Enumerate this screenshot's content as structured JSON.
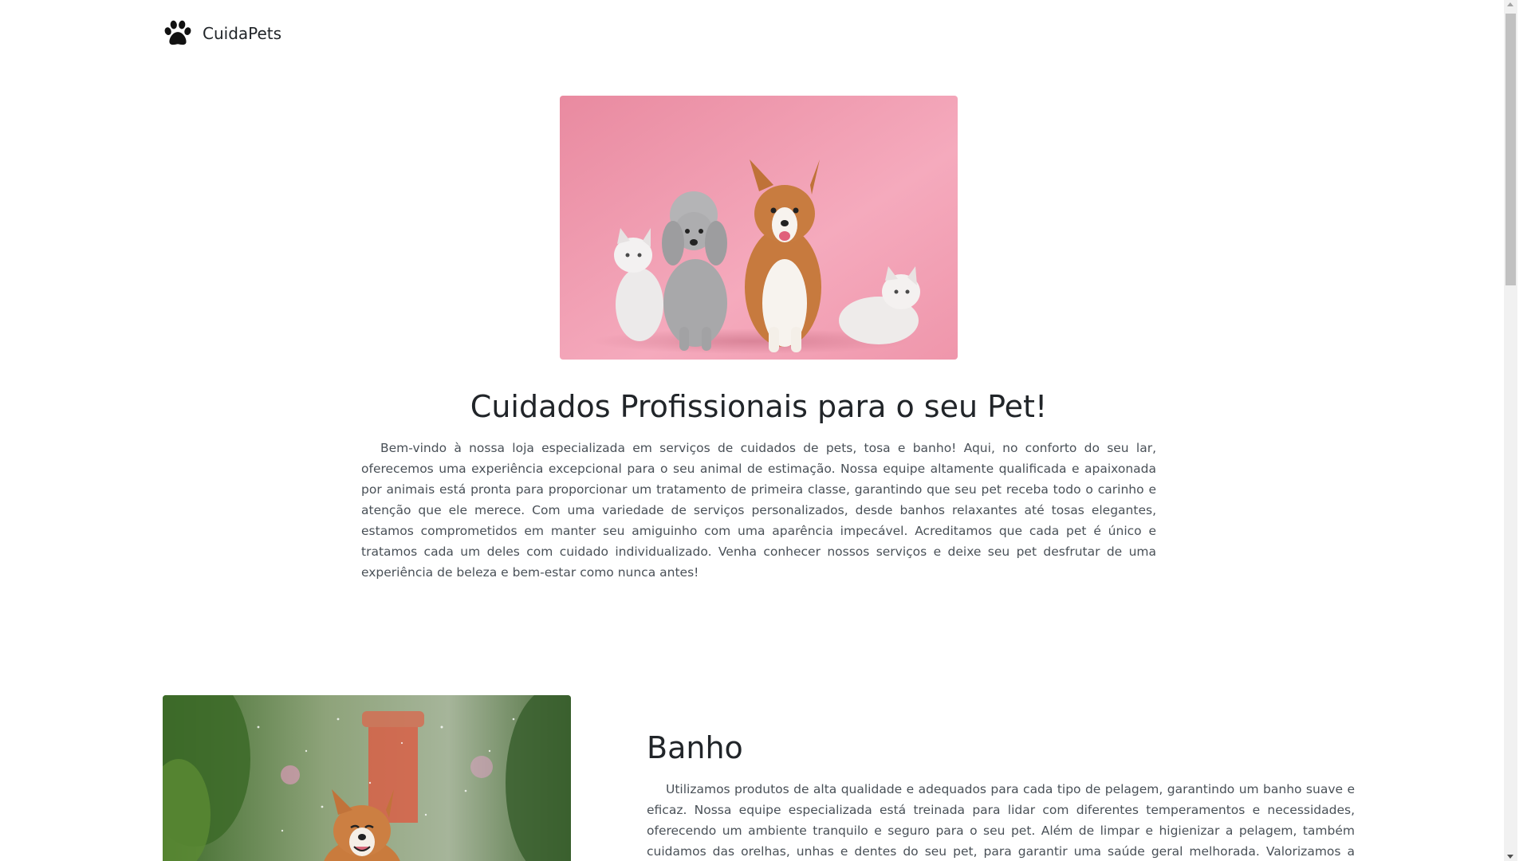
{
  "header": {
    "brand_name": "CuidaPets",
    "logo_icon": "paw-icon"
  },
  "hero": {
    "image_description_icon": "pets-photo",
    "title": "Cuidados Profissionais para o seu Pet!",
    "text": "Bem-vindo à nossa loja especializada em serviços de cuidados de pets, tosa e banho! Aqui, no conforto do seu lar, oferecemos uma experiência excepcional para o seu animal de estimação. Nossa equipe altamente qualificada e apaixonada por animais está pronta para proporcionar um tratamento de primeira classe, garantindo que seu pet receba todo o carinho e atenção que ele merece. Com uma variedade de serviços personalizados, desde banhos relaxantes até tosas elegantes, estamos comprometidos em manter seu amiguinho com uma aparência impecável. Acreditamos que cada pet é único e tratamos cada um deles com cuidado individualizado. Venha conhecer nossos serviços e deixe seu pet desfrutar de uma experiência de beleza e bem-estar como nunca antes!"
  },
  "service": {
    "title": "Banho",
    "text": "Utilizamos produtos de alta qualidade e adequados para cada tipo de pelagem, garantindo um banho suave e eficaz. Nossa equipe especializada está treinada para lidar com diferentes temperamentos e necessidades, oferecendo um ambiente tranquilo e seguro para o seu pet. Além de limpar e higienizar a pelagem, também cuidamos das orelhas, unhas e dentes do seu pet, para garantir uma saúde geral melhorada. Valorizamos a individualidade de cada pet e adaptamos o banho de"
  },
  "colors": {
    "hero_bg_pink": "#f2a3b6",
    "text_dark": "#212529",
    "text_body": "#495057"
  }
}
